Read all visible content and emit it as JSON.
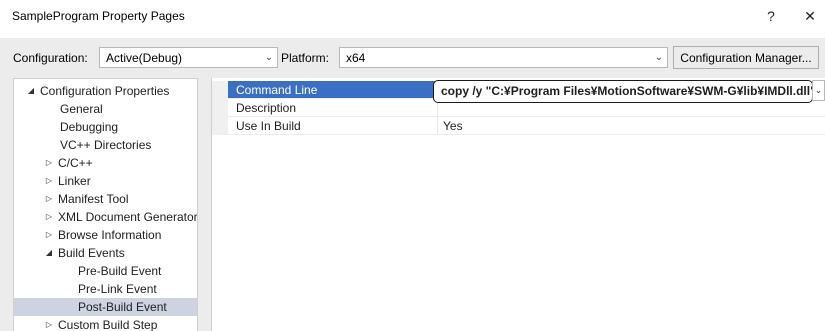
{
  "window": {
    "title": "SampleProgram Property Pages",
    "help_glyph": "?",
    "close_glyph": "✕"
  },
  "toolbar": {
    "configuration_label": "Configuration:",
    "configuration_value": "Active(Debug)",
    "platform_label": "Platform:",
    "platform_value": "x64",
    "config_manager_label": "Configuration Manager...",
    "chevron_icon": "chevron-down-icon"
  },
  "tree": {
    "items": [
      {
        "label": "Configuration Properties",
        "level": 0,
        "expander": "expanded"
      },
      {
        "label": "General",
        "level": 1,
        "expander": "none"
      },
      {
        "label": "Debugging",
        "level": 1,
        "expander": "none"
      },
      {
        "label": "VC++ Directories",
        "level": 1,
        "expander": "none"
      },
      {
        "label": "C/C++",
        "level": 1,
        "expander": "collapsed"
      },
      {
        "label": "Linker",
        "level": 1,
        "expander": "collapsed"
      },
      {
        "label": "Manifest Tool",
        "level": 1,
        "expander": "collapsed"
      },
      {
        "label": "XML Document Generator",
        "level": 1,
        "expander": "collapsed"
      },
      {
        "label": "Browse Information",
        "level": 1,
        "expander": "collapsed"
      },
      {
        "label": "Build Events",
        "level": 1,
        "expander": "expanded"
      },
      {
        "label": "Pre-Build Event",
        "level": 2,
        "expander": "none"
      },
      {
        "label": "Pre-Link Event",
        "level": 2,
        "expander": "none"
      },
      {
        "label": "Post-Build Event",
        "level": 2,
        "expander": "none",
        "selected": true
      },
      {
        "label": "Custom Build Step",
        "level": 1,
        "expander": "collapsed"
      }
    ]
  },
  "properties": {
    "rows": [
      {
        "name": "Command Line",
        "value": "copy /y \"C:¥Program Files¥MotionSoftware¥SWM-G¥lib¥IMDll.dll\"",
        "selected": true
      },
      {
        "name": "Description",
        "value": ""
      },
      {
        "name": "Use In Build",
        "value": "Yes"
      }
    ]
  },
  "colors": {
    "selection_blue": "#3a6fc4",
    "tree_selection": "#cdd3e0",
    "panel_bg": "#ececec"
  }
}
